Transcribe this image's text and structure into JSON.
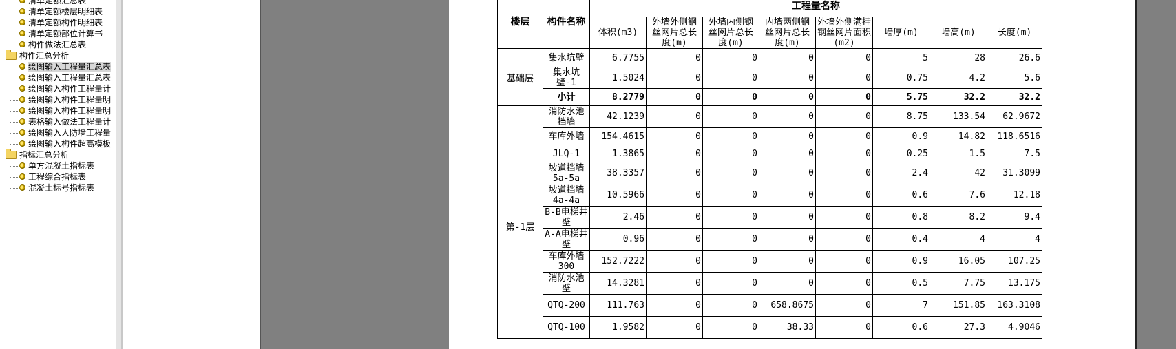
{
  "tree": {
    "items": [
      {
        "type": "leaf",
        "label": "清单定额汇总表",
        "indent": 1
      },
      {
        "type": "leaf",
        "label": "清单定额楼层明细表",
        "indent": 1
      },
      {
        "type": "leaf",
        "label": "清单定额构件明细表",
        "indent": 1
      },
      {
        "type": "leaf",
        "label": "清单定额部位计算书",
        "indent": 1
      },
      {
        "type": "leaf",
        "label": "构件做法汇总表",
        "indent": 1
      },
      {
        "type": "folder",
        "label": "构件汇总分析",
        "indent": 0
      },
      {
        "type": "leaf",
        "label": "绘图输入工程量汇总表",
        "indent": 1,
        "selected": true
      },
      {
        "type": "leaf",
        "label": "绘图输入工程量汇总表",
        "indent": 1
      },
      {
        "type": "leaf",
        "label": "绘图输入构件工程量计",
        "indent": 1
      },
      {
        "type": "leaf",
        "label": "绘图输入构件工程量明",
        "indent": 1
      },
      {
        "type": "leaf",
        "label": "绘图输入构件工程量明",
        "indent": 1
      },
      {
        "type": "leaf",
        "label": "表格输入做法工程量计",
        "indent": 1
      },
      {
        "type": "leaf",
        "label": "绘图输入人防墙工程量",
        "indent": 1
      },
      {
        "type": "leaf",
        "label": "绘图输入构件超高模板",
        "indent": 1
      },
      {
        "type": "folder",
        "label": "指标汇总分析",
        "indent": 0
      },
      {
        "type": "leaf",
        "label": "单方混凝土指标表",
        "indent": 1
      },
      {
        "type": "leaf",
        "label": "工程综合指标表",
        "indent": 1
      },
      {
        "type": "leaf",
        "label": "混凝土标号指标表",
        "indent": 1
      }
    ]
  },
  "table": {
    "header": {
      "floor": "楼层",
      "component": "构件名称",
      "group": "工程量名称",
      "columns": [
        "体积(m3)",
        "外墙外侧钢丝网片总长度(m)",
        "外墙内侧钢丝网片总长度(m)",
        "内墙两侧钢丝网片总长度(m)",
        "外墙外侧满挂钢丝网片面积(m2)",
        "墙厚(m)",
        "墙高(m)",
        "长度(m)"
      ]
    },
    "groups": [
      {
        "floor": "基础层",
        "rows": [
          {
            "name": "集水坑壁",
            "values": [
              "6.7755",
              "0",
              "0",
              "0",
              "0",
              "5",
              "28",
              "26.6"
            ]
          },
          {
            "name": "集水坑壁-1",
            "values": [
              "1.5024",
              "0",
              "0",
              "0",
              "0",
              "0.75",
              "4.2",
              "5.6"
            ]
          },
          {
            "name": "小计",
            "subtotal": true,
            "values": [
              "8.2779",
              "0",
              "0",
              "0",
              "0",
              "5.75",
              "32.2",
              "32.2"
            ]
          }
        ]
      },
      {
        "floor": "第-1层",
        "rows": [
          {
            "name": "消防水池挡墙",
            "values": [
              "42.1239",
              "0",
              "0",
              "0",
              "0",
              "8.75",
              "133.54",
              "62.9672"
            ]
          },
          {
            "name": "车库外墙",
            "values": [
              "154.4615",
              "0",
              "0",
              "0",
              "0",
              "0.9",
              "14.82",
              "118.6516"
            ]
          },
          {
            "name": "JLQ-1",
            "values": [
              "1.3865",
              "0",
              "0",
              "0",
              "0",
              "0.25",
              "1.5",
              "7.5"
            ]
          },
          {
            "name": "坡道挡墙5a-5a",
            "values": [
              "38.3357",
              "0",
              "0",
              "0",
              "0",
              "2.4",
              "42",
              "31.3099"
            ]
          },
          {
            "name": "坡道挡墙4a-4a",
            "values": [
              "10.5966",
              "0",
              "0",
              "0",
              "0",
              "0.6",
              "7.6",
              "12.18"
            ]
          },
          {
            "name": "B-B电梯井壁",
            "values": [
              "2.46",
              "0",
              "0",
              "0",
              "0",
              "0.8",
              "8.2",
              "9.4"
            ]
          },
          {
            "name": "A-A电梯井壁",
            "values": [
              "0.96",
              "0",
              "0",
              "0",
              "0",
              "0.4",
              "4",
              "4"
            ]
          },
          {
            "name": "车库外墙300",
            "values": [
              "152.7222",
              "0",
              "0",
              "0",
              "0",
              "0.9",
              "16.05",
              "107.25"
            ]
          },
          {
            "name": "消防水池壁",
            "values": [
              "14.3281",
              "0",
              "0",
              "0",
              "0",
              "0.5",
              "7.75",
              "13.175"
            ]
          },
          {
            "name": "QTQ-200",
            "values": [
              "111.763",
              "0",
              "0",
              "658.8675",
              "0",
              "7",
              "151.85",
              "163.3108"
            ]
          },
          {
            "name": "QTQ-100",
            "values": [
              "1.9582",
              "0",
              "0",
              "38.33",
              "0",
              "0.6",
              "27.3",
              "4.9046"
            ]
          }
        ]
      }
    ]
  }
}
